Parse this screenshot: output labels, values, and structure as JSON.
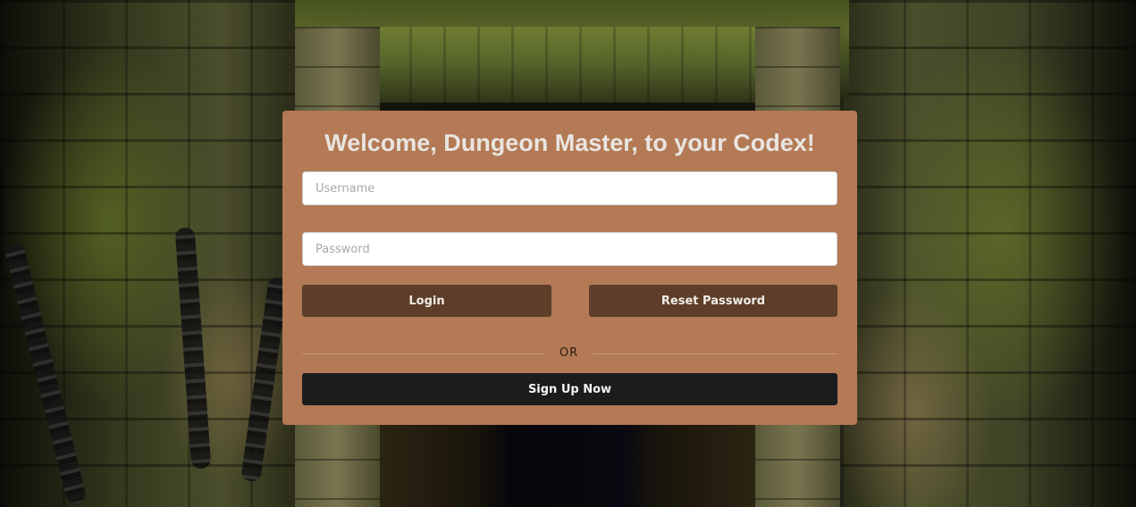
{
  "login_card": {
    "title": "Welcome, Dungeon Master, to your Codex!",
    "username_placeholder": "Username",
    "password_placeholder": "Password",
    "login_label": "Login",
    "reset_password_label": "Reset Password",
    "divider_text": "OR",
    "signup_label": "Sign Up Now"
  },
  "colors": {
    "card_background": "#b37a55",
    "primary_button": "#5c3e29",
    "signup_button": "#1b1c1e",
    "title_text": "#e9e5e1"
  }
}
